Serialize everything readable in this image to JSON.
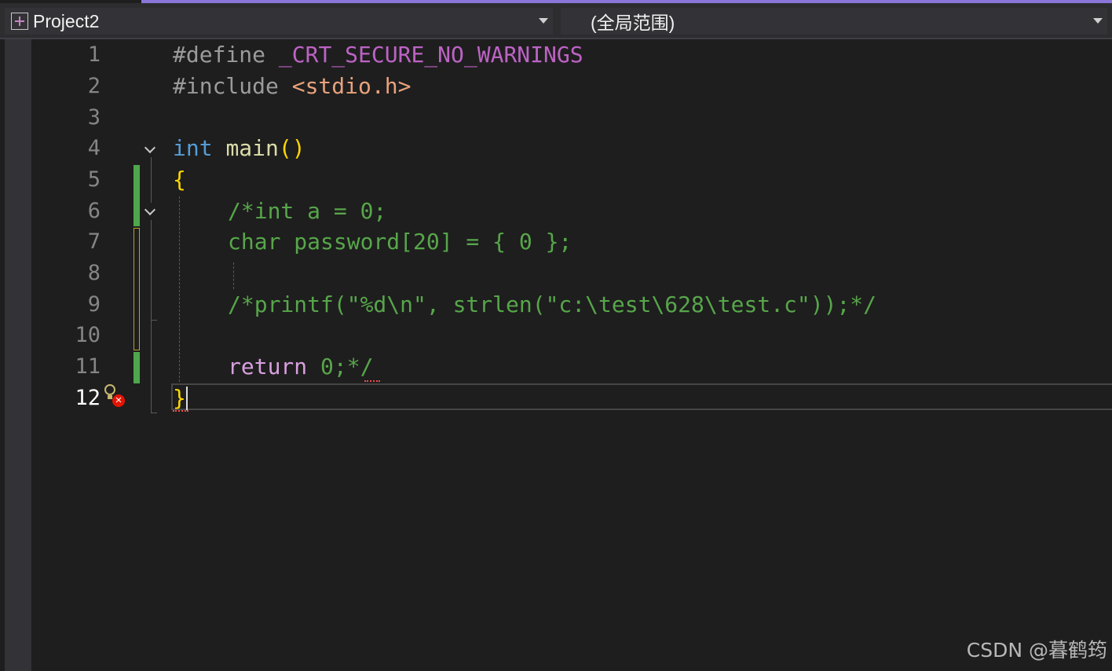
{
  "navbar": {
    "project": "Project2",
    "scope": "(全局范围)"
  },
  "lines": [
    {
      "num": "1"
    },
    {
      "num": "2"
    },
    {
      "num": "3"
    },
    {
      "num": "4"
    },
    {
      "num": "5"
    },
    {
      "num": "6"
    },
    {
      "num": "7"
    },
    {
      "num": "8"
    },
    {
      "num": "9"
    },
    {
      "num": "10"
    },
    {
      "num": "11"
    },
    {
      "num": "12"
    }
  ],
  "code": {
    "l1": {
      "directive": "#define",
      "macro": "_CRT_SECURE_NO_WARNINGS"
    },
    "l2": {
      "directive": "#include",
      "header": "<stdio.h>"
    },
    "l4": {
      "type": "int",
      "name": "main",
      "parens": "()"
    },
    "l5": {
      "brace": "{"
    },
    "l6": {
      "text": "/*int a = 0;"
    },
    "l7": {
      "text": "char password[20] = { 0 };"
    },
    "l9": {
      "text": "/*printf(\"%d\\n\", strlen(\"c:\\test\\628\\test.c\"));*/"
    },
    "l11": {
      "text": "return 0;*/"
    },
    "l12": {
      "brace": "}"
    }
  },
  "watermark": "CSDN @暮鹤筠",
  "colors": {
    "background": "#1e1e1e",
    "comment": "#57a64a",
    "keyword": "#569cd6",
    "preprocessor": "#9b9b9b",
    "macro": "#bd63c5",
    "string": "#e8a27c",
    "function": "#dcdcaa",
    "brace": "#ffd700",
    "error": "#e51400"
  }
}
